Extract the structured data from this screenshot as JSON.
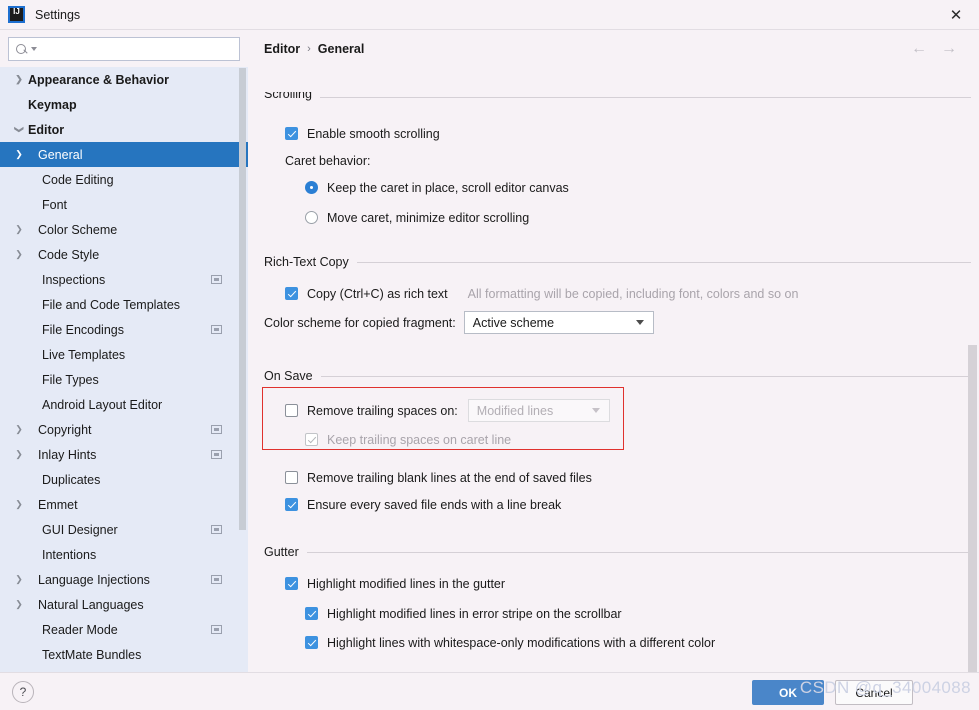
{
  "window": {
    "title": "Settings",
    "logo_icon": "intellij-idea-logo",
    "close_icon": "close-icon"
  },
  "search": {
    "value": "",
    "placeholder": "",
    "icon": "search-icon",
    "dropdown_icon": "search-filter-caret-icon"
  },
  "sidebar": {
    "items": [
      {
        "label": "Appearance & Behavior",
        "depth": 0,
        "arrow": "right",
        "bold": true,
        "selected": false,
        "badge": false
      },
      {
        "label": "Keymap",
        "depth": 0,
        "arrow": "none",
        "bold": true,
        "selected": false,
        "badge": false
      },
      {
        "label": "Editor",
        "depth": 0,
        "arrow": "down",
        "bold": true,
        "selected": false,
        "badge": false
      },
      {
        "label": "General",
        "depth": 1,
        "arrow": "right",
        "bold": false,
        "selected": true,
        "badge": false
      },
      {
        "label": "Code Editing",
        "depth": 1,
        "arrow": "none",
        "bold": false,
        "selected": false,
        "badge": false
      },
      {
        "label": "Font",
        "depth": 1,
        "arrow": "none",
        "bold": false,
        "selected": false,
        "badge": false
      },
      {
        "label": "Color Scheme",
        "depth": 1,
        "arrow": "right",
        "bold": false,
        "selected": false,
        "badge": false
      },
      {
        "label": "Code Style",
        "depth": 1,
        "arrow": "right",
        "bold": false,
        "selected": false,
        "badge": false
      },
      {
        "label": "Inspections",
        "depth": 1,
        "arrow": "none",
        "bold": false,
        "selected": false,
        "badge": true
      },
      {
        "label": "File and Code Templates",
        "depth": 1,
        "arrow": "none",
        "bold": false,
        "selected": false,
        "badge": false
      },
      {
        "label": "File Encodings",
        "depth": 1,
        "arrow": "none",
        "bold": false,
        "selected": false,
        "badge": true
      },
      {
        "label": "Live Templates",
        "depth": 1,
        "arrow": "none",
        "bold": false,
        "selected": false,
        "badge": false
      },
      {
        "label": "File Types",
        "depth": 1,
        "arrow": "none",
        "bold": false,
        "selected": false,
        "badge": false
      },
      {
        "label": "Android Layout Editor",
        "depth": 1,
        "arrow": "none",
        "bold": false,
        "selected": false,
        "badge": false
      },
      {
        "label": "Copyright",
        "depth": 1,
        "arrow": "right",
        "bold": false,
        "selected": false,
        "badge": true
      },
      {
        "label": "Inlay Hints",
        "depth": 1,
        "arrow": "right",
        "bold": false,
        "selected": false,
        "badge": true
      },
      {
        "label": "Duplicates",
        "depth": 1,
        "arrow": "none",
        "bold": false,
        "selected": false,
        "badge": false
      },
      {
        "label": "Emmet",
        "depth": 1,
        "arrow": "right",
        "bold": false,
        "selected": false,
        "badge": false
      },
      {
        "label": "GUI Designer",
        "depth": 1,
        "arrow": "none",
        "bold": false,
        "selected": false,
        "badge": true
      },
      {
        "label": "Intentions",
        "depth": 1,
        "arrow": "none",
        "bold": false,
        "selected": false,
        "badge": false
      },
      {
        "label": "Language Injections",
        "depth": 1,
        "arrow": "right",
        "bold": false,
        "selected": false,
        "badge": true
      },
      {
        "label": "Natural Languages",
        "depth": 1,
        "arrow": "right",
        "bold": false,
        "selected": false,
        "badge": false
      },
      {
        "label": "Reader Mode",
        "depth": 1,
        "arrow": "none",
        "bold": false,
        "selected": false,
        "badge": true
      },
      {
        "label": "TextMate Bundles",
        "depth": 1,
        "arrow": "none",
        "bold": false,
        "selected": false,
        "badge": false
      }
    ]
  },
  "breadcrumb": {
    "root": "Editor",
    "separator": "›",
    "leaf": "General"
  },
  "nav": {
    "back_icon": "arrow-left-icon",
    "forward_icon": "arrow-right-icon",
    "back_label": "←",
    "forward_label": "→"
  },
  "sections": {
    "scrolling": {
      "title": "Scrolling",
      "enable_smooth_scrolling": {
        "label": "Enable smooth scrolling",
        "checked": true
      },
      "caret_behavior_label": "Caret behavior:",
      "radios": [
        {
          "label": "Keep the caret in place, scroll editor canvas",
          "selected": true
        },
        {
          "label": "Move caret, minimize editor scrolling",
          "selected": false
        }
      ]
    },
    "rich_text_copy": {
      "title": "Rich-Text Copy",
      "copy_rich_text": {
        "label": "Copy (Ctrl+C) as rich text",
        "checked": true
      },
      "copy_hint": "All formatting will be copied, including font, colors and so on",
      "color_scheme_label": "Color scheme for copied fragment:",
      "color_scheme_value": "Active scheme"
    },
    "on_save": {
      "title": "On Save",
      "remove_trailing_spaces": {
        "label": "Remove trailing spaces on:",
        "checked": false
      },
      "remove_trailing_spaces_value": "Modified lines",
      "keep_trailing_spaces": {
        "label": "Keep trailing spaces on caret line",
        "checked": true,
        "disabled": true
      },
      "remove_blank_lines": {
        "label": "Remove trailing blank lines at the end of saved files",
        "checked": false
      },
      "ensure_line_break": {
        "label": "Ensure every saved file ends with a line break",
        "checked": true
      },
      "highlight_color": "#e0322e"
    },
    "gutter": {
      "title": "Gutter",
      "highlight_modified": {
        "label": "Highlight modified lines in the gutter",
        "checked": true
      },
      "highlight_error_stripe": {
        "label": "Highlight modified lines in error stripe on the scrollbar",
        "checked": true
      },
      "highlight_whitespace": {
        "label": "Highlight lines with whitespace-only modifications with a different color",
        "checked": true
      }
    }
  },
  "footer": {
    "help_label": "?",
    "ok_label": "OK",
    "cancel_label": "Cancel"
  },
  "watermark": "CSDN @q_34004088",
  "colors": {
    "accent": "#4a86c9",
    "selection": "#2675bf",
    "checkbox_on": "#3d92e0",
    "sidebar_bg": "#e5eaf6",
    "panel_bg": "#f7f2f6",
    "highlight_box": "#e0322e"
  }
}
